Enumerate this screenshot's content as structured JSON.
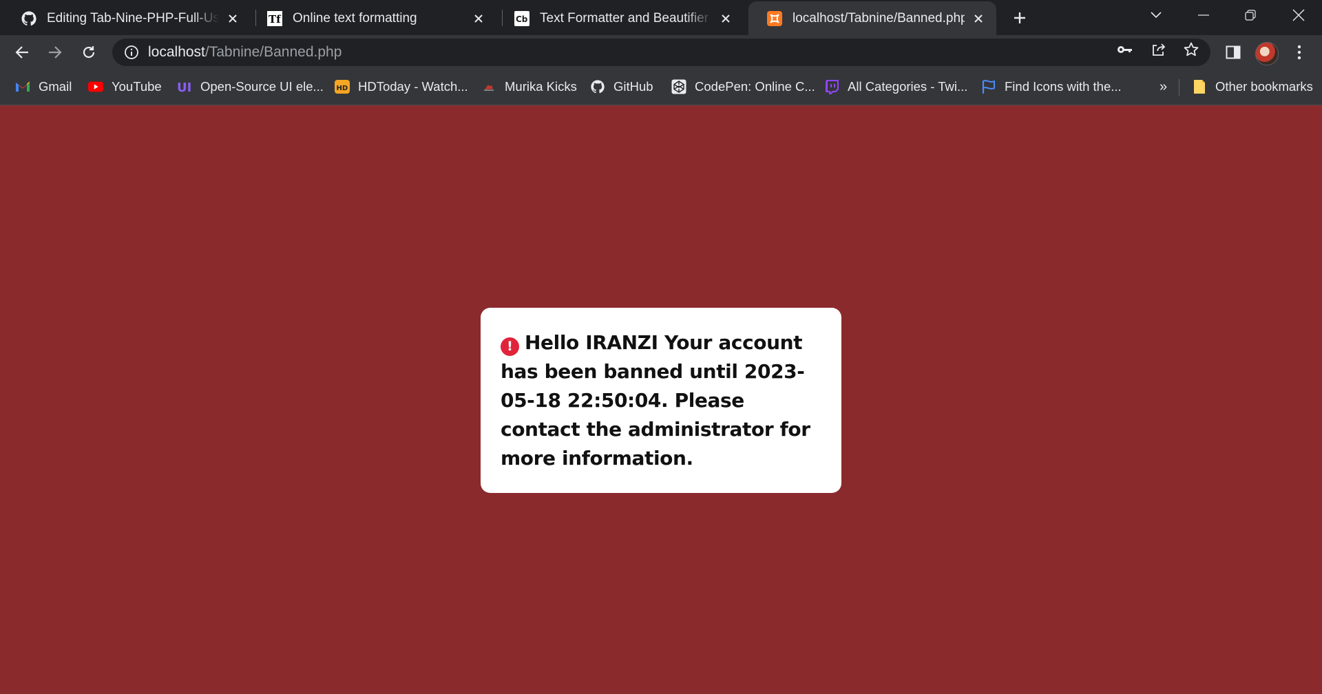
{
  "browser": {
    "tabs": [
      {
        "title": "Editing Tab-Nine-PHP-Full-User-Auth",
        "icon": "github-icon",
        "active": false
      },
      {
        "title": "Online text formatting",
        "icon": "text-format-icon",
        "active": false
      },
      {
        "title": "Text Formatter and Beautifier to format",
        "icon": "cb-icon",
        "active": false
      },
      {
        "title": "localhost/Tabnine/Banned.php",
        "icon": "xampp-icon",
        "active": true
      }
    ],
    "address": {
      "host": "localhost",
      "path": "/Tabnine/Banned.php"
    },
    "bookmarks": [
      {
        "label": "Gmail",
        "icon": "gmail-icon"
      },
      {
        "label": "YouTube",
        "icon": "youtube-icon"
      },
      {
        "label": "Open-Source UI ele...",
        "icon": "uiverse-icon"
      },
      {
        "label": "HDToday - Watch...",
        "icon": "hd-icon"
      },
      {
        "label": "Murika Kicks",
        "icon": "shoe-icon"
      },
      {
        "label": "GitHub",
        "icon": "github-icon"
      },
      {
        "label": "CodePen: Online C...",
        "icon": "codepen-icon"
      },
      {
        "label": "All Categories - Twi...",
        "icon": "twitch-icon"
      },
      {
        "label": "Find Icons with the...",
        "icon": "flag-icon"
      }
    ],
    "bookmarks_overflow": "»",
    "other_bookmarks": "Other bookmarks"
  },
  "page": {
    "background": "#8b2a2d",
    "message": "Hello IRANZI  Your account has been banned until 2023-05-18 22:50:04. Please contact the administrator for more information.",
    "alert_icon": "!",
    "alert_color": "#e0243a"
  }
}
